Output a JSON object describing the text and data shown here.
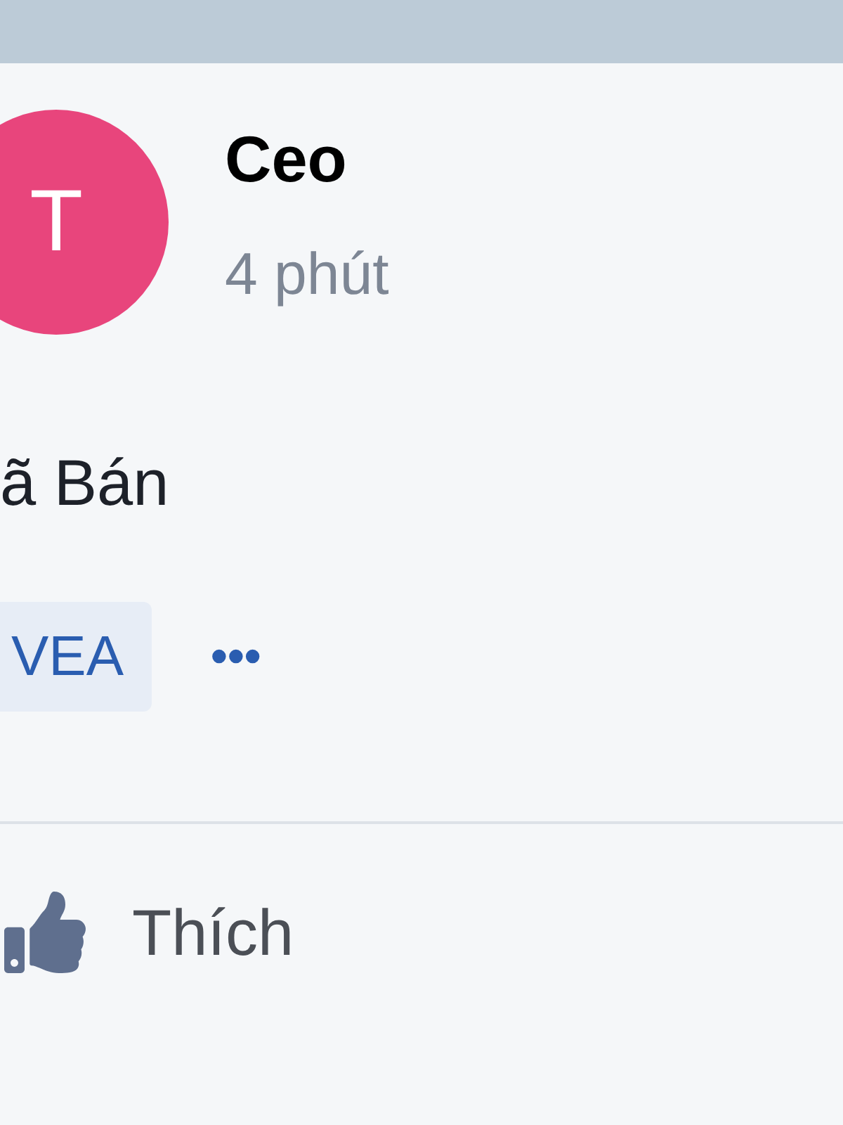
{
  "post": {
    "avatar_letter": "T",
    "author": "Ceo",
    "time": "4 phút",
    "text": "ã Bán",
    "tags": [
      "VEA"
    ],
    "more": "•••"
  },
  "actions": [
    {
      "label": "Thích"
    }
  ]
}
